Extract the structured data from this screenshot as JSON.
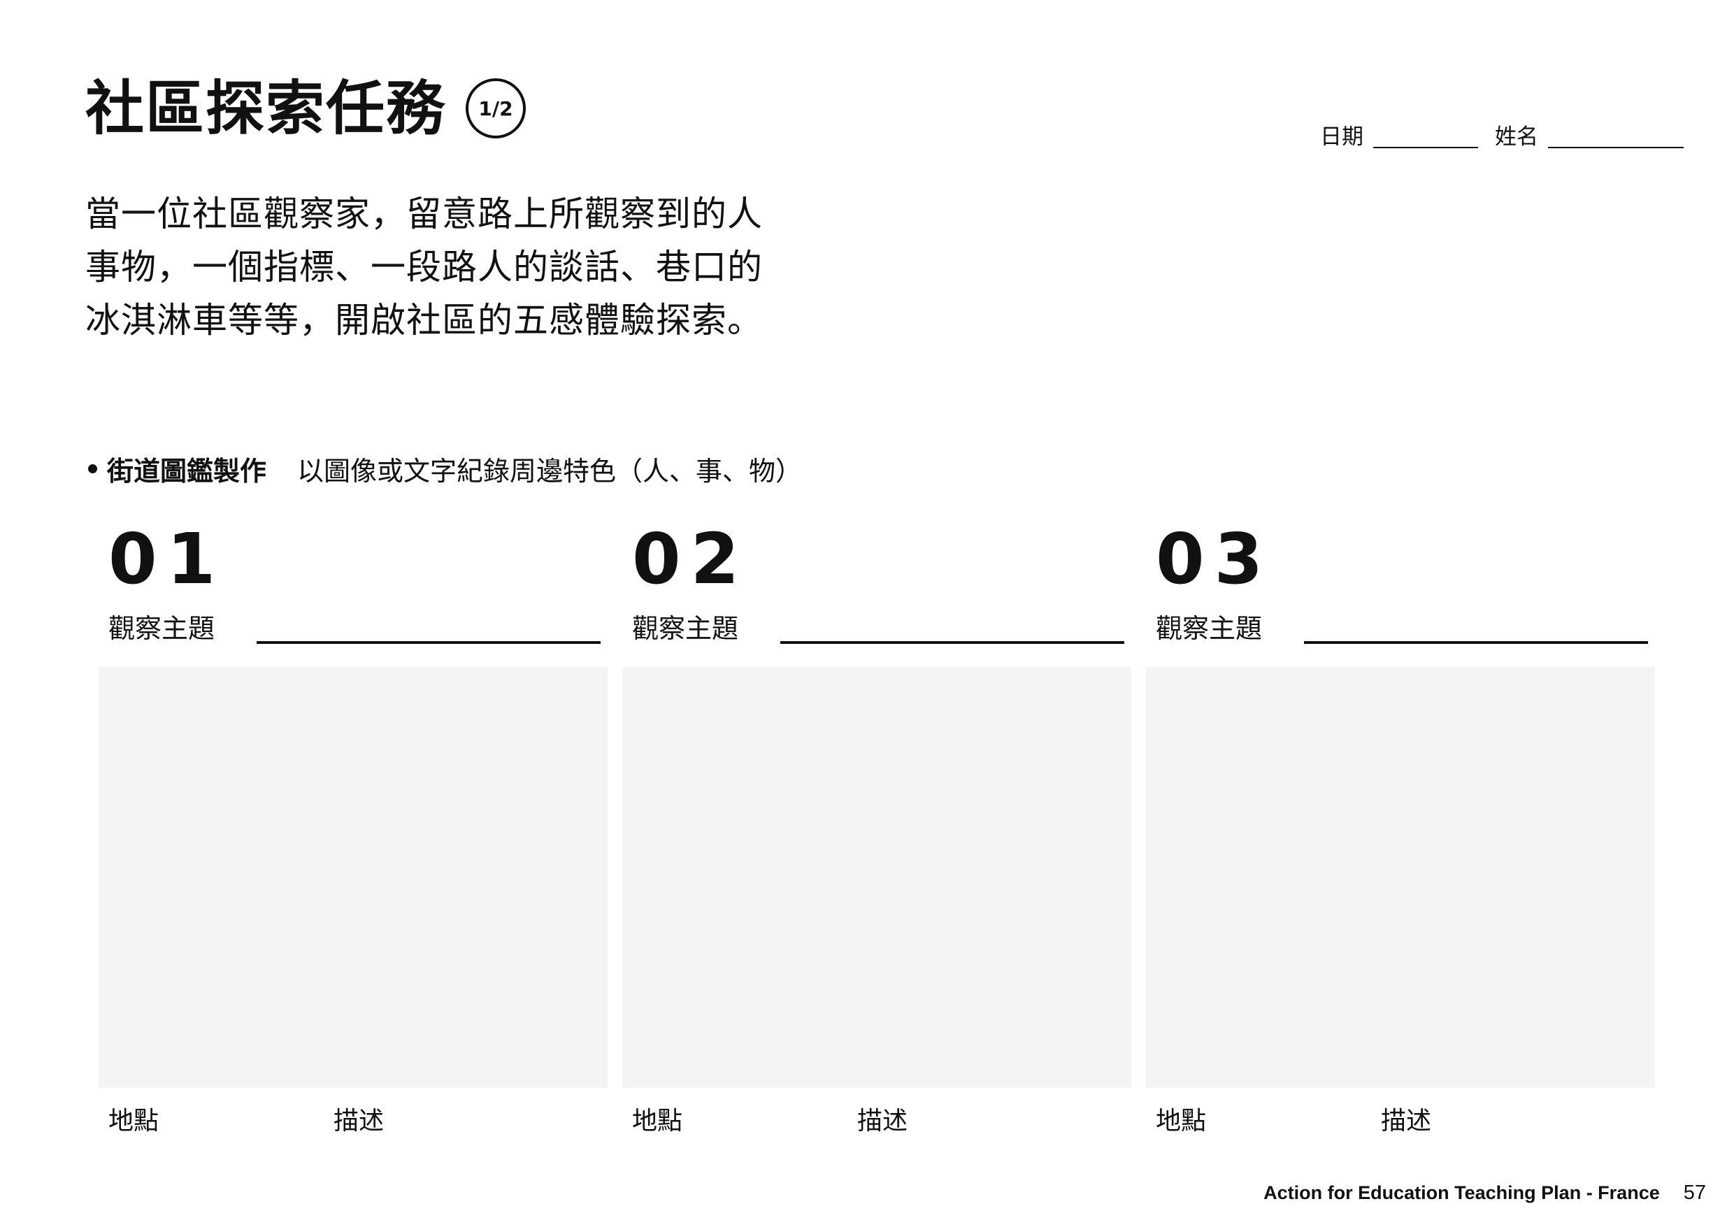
{
  "header": {
    "title": "社區探索任務",
    "page_indicator": "1/2",
    "date_label": "日期",
    "name_label": "姓名"
  },
  "intro": {
    "lines": [
      "當一位社區觀察家，留意路上所觀察到的人",
      "事物，一個指標、一段路人的談話、巷口的",
      "冰淇淋車等等，開啟社區的五感體驗探索。"
    ]
  },
  "section": {
    "title": "街道圖鑑製作",
    "subtitle": "以圖像或文字紀錄周邊特色（人、事、物）"
  },
  "cards": [
    {
      "number": "01",
      "topic_label": "觀察主題",
      "location_label": "地點",
      "description_label": "描述"
    },
    {
      "number": "02",
      "topic_label": "觀察主題",
      "location_label": "地點",
      "description_label": "描述"
    },
    {
      "number": "03",
      "topic_label": "觀察主題",
      "location_label": "地點",
      "description_label": "描述"
    }
  ],
  "footer": {
    "text": "Action for Education Teaching Plan -  France",
    "page_number": "57"
  },
  "colors": {
    "text": "#111111",
    "photo_box": "#f4f4f4",
    "background": "#ffffff"
  }
}
